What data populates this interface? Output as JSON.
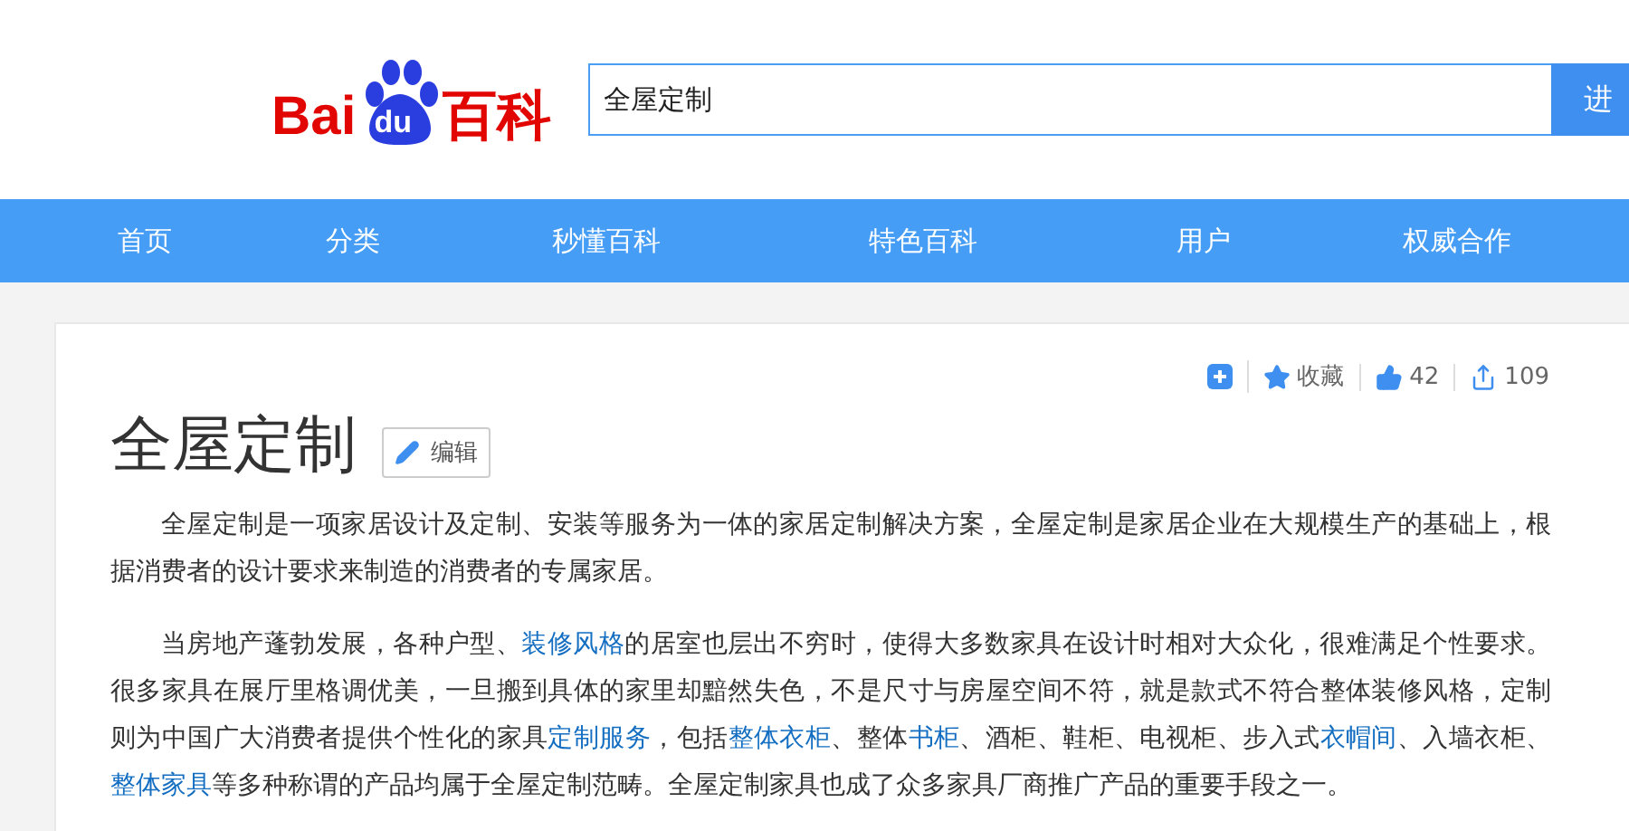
{
  "logo": {
    "parts": [
      "Bai",
      "du",
      "百科"
    ]
  },
  "search": {
    "value": "全屋定制",
    "button": "进"
  },
  "nav": {
    "items": [
      "首页",
      "分类",
      "秒懂百科",
      "特色百科",
      "用户",
      "权威合作"
    ]
  },
  "article": {
    "title": "全屋定制",
    "edit_button": "编辑",
    "actions": [
      {
        "kind": "add"
      },
      {
        "kind": "favorite",
        "label": "收藏"
      },
      {
        "kind": "like",
        "label": "42"
      },
      {
        "kind": "share",
        "label": "109"
      }
    ],
    "paragraphs": [
      [
        {
          "kind": "text",
          "text": "全屋定制是一项家居设计及定制、安装等服务为一体的家居定制解决方案，全屋定制是家居企业在大规模生产的基础上，根据消费者的设计要求来制造的消费者的专属家居。"
        }
      ],
      [
        {
          "kind": "text",
          "text": "当房地产蓬勃发展，各种户型、"
        },
        {
          "kind": "link",
          "text": "装修风格"
        },
        {
          "kind": "text",
          "text": "的居室也层出不穷时，使得大多数家具在设计时相对大众化，很难满足个性要求。很多家具在展厅里格调优美，一旦搬到具体的家里却黯然失色，不是尺寸与房屋空间不符，就是款式不符合整体装修风格，定制则为中国广大消费者提供个性化的家具"
        },
        {
          "kind": "link",
          "text": "定制服务"
        },
        {
          "kind": "text",
          "text": "，包括"
        },
        {
          "kind": "link",
          "text": "整体衣柜"
        },
        {
          "kind": "text",
          "text": "、整体"
        },
        {
          "kind": "link",
          "text": "书柜"
        },
        {
          "kind": "text",
          "text": "、酒柜、鞋柜、电视柜、步入式"
        },
        {
          "kind": "link",
          "text": "衣帽间"
        },
        {
          "kind": "text",
          "text": "、入墙衣柜、"
        },
        {
          "kind": "link",
          "text": "整体家具"
        },
        {
          "kind": "text",
          "text": "等多种称谓的产品均属于全屋定制范畴。全屋定制家具也成了众多家具厂商推广产品的重要手段之一。"
        }
      ]
    ]
  }
}
